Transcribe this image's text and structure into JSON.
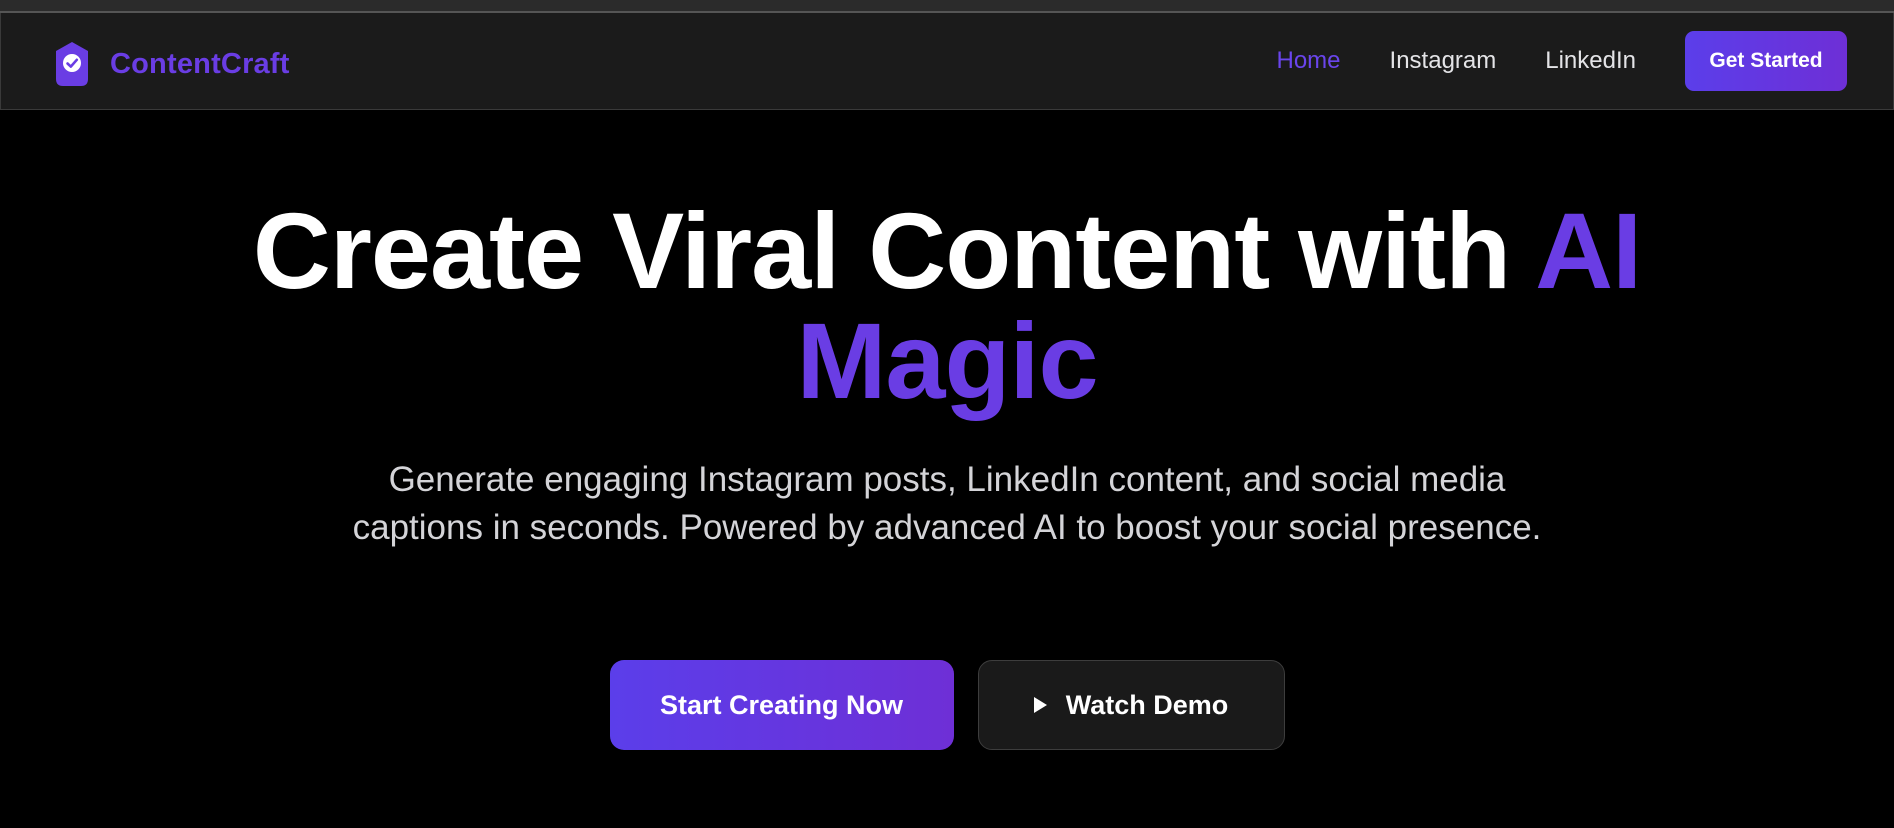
{
  "brand": {
    "name": "ContentCraft",
    "icon": "shield-check-icon",
    "color": "#6a3de4"
  },
  "nav": {
    "items": [
      {
        "label": "Home",
        "active": true
      },
      {
        "label": "Instagram",
        "active": false
      },
      {
        "label": "LinkedIn",
        "active": false
      }
    ],
    "cta_label": "Get Started"
  },
  "hero": {
    "title_main": "Create Viral Content with ",
    "title_accent_1": "AI",
    "title_accent_2": "Magic",
    "subtitle": "Generate engaging Instagram posts, LinkedIn content, and social media captions in seconds. Powered by advanced AI to boost your social presence.",
    "primary_button": "Start Creating Now",
    "secondary_button": "Watch Demo",
    "secondary_icon": "play-icon"
  },
  "colors": {
    "accent": "#6a3de4",
    "background": "#000000",
    "navbar": "#1b1b1b"
  }
}
